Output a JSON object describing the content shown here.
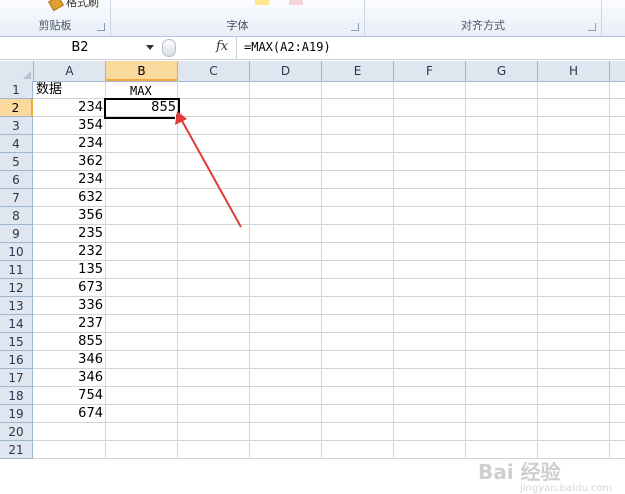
{
  "ribbon": {
    "format_painter_label": "格式刷",
    "groups": [
      {
        "label": "剪贴板"
      },
      {
        "label": "字体"
      },
      {
        "label": "对齐方式"
      }
    ]
  },
  "formula_bar": {
    "name_box": "B2",
    "fx_label": "fx",
    "formula": "=MAX(A2:A19)"
  },
  "sheet": {
    "columns": [
      "A",
      "B",
      "C",
      "D",
      "E",
      "F",
      "G",
      "H"
    ],
    "selected_column": "B",
    "rows": [
      "1",
      "2",
      "3",
      "4",
      "5",
      "6",
      "7",
      "8",
      "9",
      "10",
      "11",
      "12",
      "13",
      "14",
      "15",
      "16",
      "17",
      "18",
      "19",
      "20",
      "21"
    ],
    "selected_row": "2",
    "header_a": "数据",
    "header_b": "MAX",
    "a_values": [
      "234",
      "354",
      "234",
      "362",
      "234",
      "632",
      "356",
      "235",
      "232",
      "135",
      "673",
      "336",
      "237",
      "855",
      "346",
      "346",
      "754",
      "674"
    ],
    "b2_value": "855"
  },
  "annotation": {
    "arrow_color": "#e03a3a"
  },
  "watermark": {
    "text": "Bai 经验",
    "sub": "jingyan.baidu.com"
  }
}
